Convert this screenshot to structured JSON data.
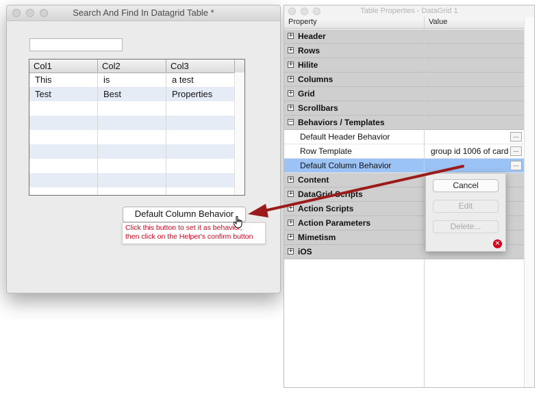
{
  "left_window": {
    "title": "Search And Find In Datagrid Table *",
    "search_value": "",
    "grid": {
      "columns": [
        "Col1",
        "Col2",
        "Col3"
      ],
      "rows": [
        [
          "This",
          "is",
          "a test"
        ],
        [
          "Test",
          "Best",
          "Properties"
        ]
      ]
    },
    "button_label": "Default Column Behavior",
    "tooltip_line1": "Click this button to set it as behavior,",
    "tooltip_line2": "then click on the Helper's confirm button"
  },
  "right_window": {
    "title": "Table Properties - DataGrid 1",
    "header_property": "Property",
    "header_value": "Value",
    "groups_before": [
      {
        "label": "Header",
        "toggle": "+"
      },
      {
        "label": "Rows",
        "toggle": "+"
      },
      {
        "label": "Hilite",
        "toggle": "+"
      },
      {
        "label": "Columns",
        "toggle": "+"
      },
      {
        "label": "Grid",
        "toggle": "+"
      },
      {
        "label": "Scrollbars",
        "toggle": "+"
      },
      {
        "label": "Behaviors / Templates",
        "toggle": "−"
      }
    ],
    "items": [
      {
        "label": "Default Header Behavior",
        "value": "",
        "button": "..."
      },
      {
        "label": "Row Template",
        "value": "group id 1006 of card",
        "button": "..."
      },
      {
        "label": "Default Column Behavior",
        "value": "",
        "button": "..."
      }
    ],
    "groups_after": [
      {
        "label": "Content",
        "toggle": "+"
      },
      {
        "label": "DataGrid Scripts",
        "toggle": "+"
      },
      {
        "label": "Action Scripts",
        "toggle": "+"
      },
      {
        "label": "Action Parameters",
        "toggle": "+"
      },
      {
        "label": "Mimetism",
        "toggle": "+"
      },
      {
        "label": "iOS",
        "toggle": "+"
      }
    ]
  },
  "popup": {
    "cancel": "Cancel",
    "edit": "Edit",
    "delete": "Delete..."
  },
  "colors": {
    "selected_row": "#9cc3f5",
    "tooltip_text": "#d0021b",
    "arrow": "#9b1b1b",
    "alt_row": "#e6ecf6"
  }
}
